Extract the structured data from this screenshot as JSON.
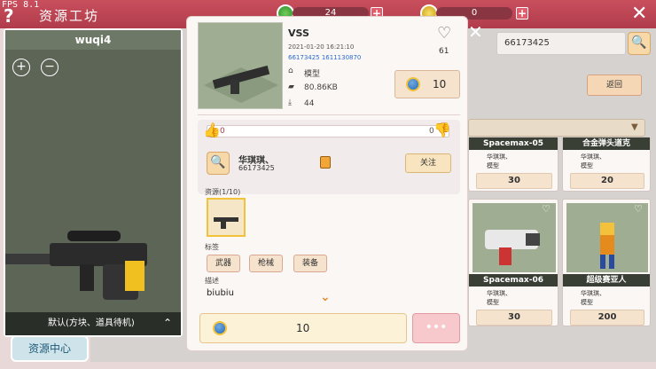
{
  "topbar": {
    "fps": "FPS 8.1",
    "title": "资源工坊",
    "help": "?",
    "currency1": "24",
    "currency2": "0",
    "close": "✕"
  },
  "left_panel": {
    "title": "wuqi4",
    "footer": "默认(方块、道具待机)",
    "zoom_in": "+",
    "zoom_out": "−",
    "collapse": "⌃"
  },
  "resource_center": "资源中心",
  "detail": {
    "name": "VSS",
    "date": "2021-01-20  16:21:10",
    "ids": "66173425  1611130870",
    "type": "模型",
    "size": "80.86KB",
    "downloads": "44",
    "likes": "61",
    "price": "10",
    "like_count": "0",
    "dislike_count": "0",
    "author": "华琪琪、",
    "author_id": "66173425",
    "follow": "关注",
    "resources_label": "资源(1/10)",
    "tags_label": "标签",
    "tags": [
      "武器",
      "枪械",
      "装备"
    ],
    "desc_label": "描述",
    "desc": "biubiu",
    "buy_price": "10",
    "more": "•••",
    "close": "✕"
  },
  "right": {
    "search_value": "66173425",
    "return": "返回",
    "cards": [
      {
        "title": "Spacemax-05",
        "author": "华琪琪、",
        "type": "模型",
        "price": "30"
      },
      {
        "title": "合金弹头道克",
        "author": "华琪琪、",
        "type": "模型",
        "price": "20"
      },
      {
        "title": "Spacemax-06",
        "author": "华琪琪、",
        "type": "模型",
        "price": "30"
      },
      {
        "title": "超级赛亚人",
        "author": "华琪琪、",
        "type": "模型",
        "price": "200"
      }
    ]
  },
  "colors": {
    "topbar": "#c94f5d",
    "accent": "#f2c23a",
    "link": "#2a6bd3"
  }
}
